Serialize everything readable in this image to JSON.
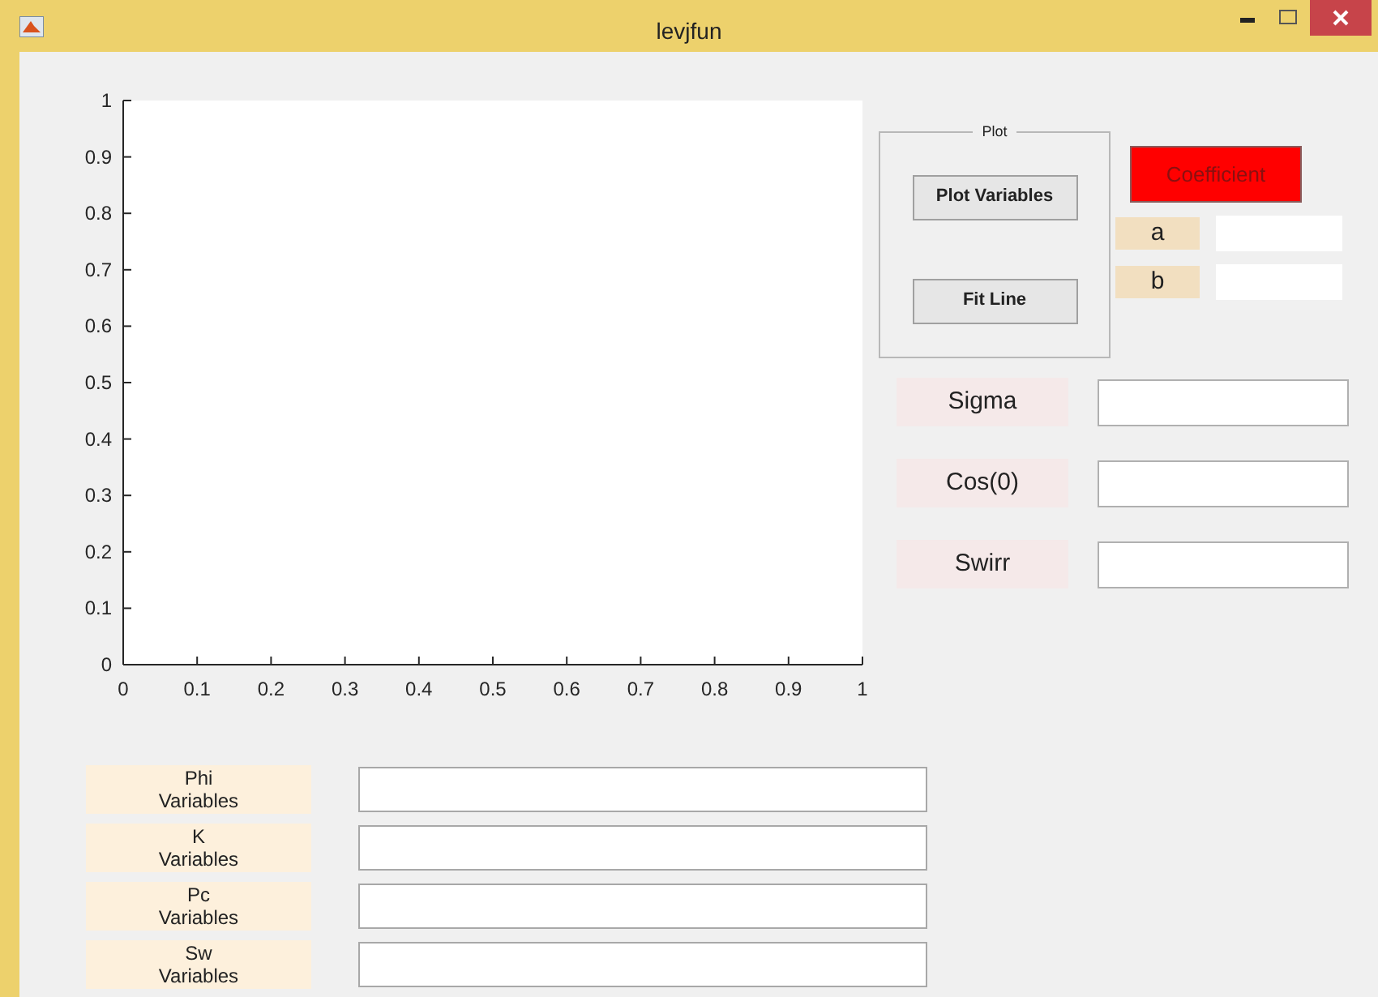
{
  "window": {
    "title": "levjfun"
  },
  "axes": {
    "chart_data": {
      "type": "line",
      "xlim": [
        0,
        1
      ],
      "ylim": [
        0,
        1
      ],
      "xticks": [
        0,
        0.1,
        0.2,
        0.3,
        0.4,
        0.5,
        0.6,
        0.7,
        0.8,
        0.9,
        1
      ],
      "yticks": [
        0,
        0.1,
        0.2,
        0.3,
        0.4,
        0.5,
        0.6,
        0.7,
        0.8,
        0.9,
        1
      ]
    }
  },
  "plot_panel": {
    "title": "Plot",
    "buttons": [
      "Plot Variables",
      "Fit Line"
    ]
  },
  "coefficient": {
    "button": "Coefficient",
    "fields": [
      {
        "label": "a"
      },
      {
        "label": "b"
      }
    ]
  },
  "parameters": [
    {
      "label": "Sigma"
    },
    {
      "label": "Cos(0)"
    },
    {
      "label": "Swirr"
    }
  ],
  "variables": [
    {
      "label": "Phi\nVariables"
    },
    {
      "label": "K\nVariables"
    },
    {
      "label": "Pc\nVariables"
    },
    {
      "label": "Sw\nVariables"
    }
  ]
}
